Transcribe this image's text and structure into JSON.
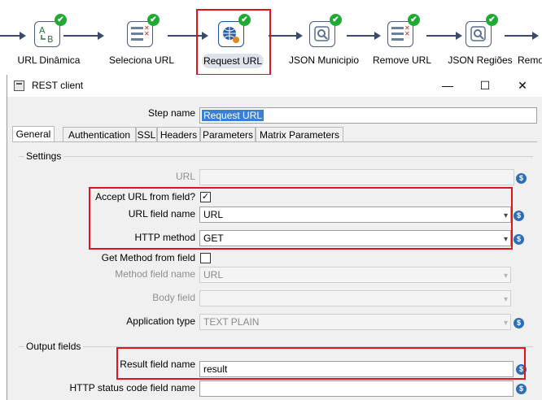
{
  "pipeline": {
    "steps": [
      {
        "label": "URL Dinâmica",
        "icon": "random-ab-icon"
      },
      {
        "label": "Seleciona URL",
        "icon": "select-values-icon"
      },
      {
        "label": "Request URL",
        "icon": "rest-client-icon"
      },
      {
        "label": "JSON Municipio",
        "icon": "json-input-icon"
      },
      {
        "label": "Remove URL",
        "icon": "select-values-icon"
      },
      {
        "label": "JSON Regiões",
        "icon": "json-input-icon"
      },
      {
        "label": "Remo",
        "icon": "select-values-icon"
      }
    ],
    "check_mark": "✔"
  },
  "dialog": {
    "title": "REST client",
    "window_buttons": {
      "minimize": "—",
      "maximize": "☐",
      "close": "✕"
    },
    "step_name_label": "Step name",
    "step_name_value": "Request URL",
    "tabs": [
      "General",
      "Authentication",
      "SSL",
      "Headers",
      "Parameters",
      "Matrix Parameters"
    ],
    "active_tab": "General",
    "settings": {
      "title": "Settings",
      "url_label": "URL",
      "url_value": "",
      "accept_url_label": "Accept URL from field?",
      "accept_url_checked": true,
      "accept_url_mark": "✓",
      "url_field_name_label": "URL field name",
      "url_field_name_value": "URL",
      "http_method_label": "HTTP method",
      "http_method_value": "GET",
      "get_method_label": "Get Method from field",
      "get_method_checked": false,
      "method_field_name_label": "Method field name",
      "method_field_name_value": "URL",
      "body_field_label": "Body field",
      "body_field_value": "",
      "application_type_label": "Application type",
      "application_type_value": "TEXT PLAIN"
    },
    "output": {
      "title": "Output fields",
      "result_field_label": "Result field name",
      "result_field_value": "result",
      "http_status_label": "HTTP status code field name",
      "http_status_value": ""
    },
    "variable_icon_glyph": "$",
    "dropdown_glyph": "▾"
  },
  "colors": {
    "highlight_red": "#e1141b",
    "check_green": "#1faa34",
    "selection_blue": "#3b7fd5",
    "variable_blue": "#2e6eb5"
  }
}
